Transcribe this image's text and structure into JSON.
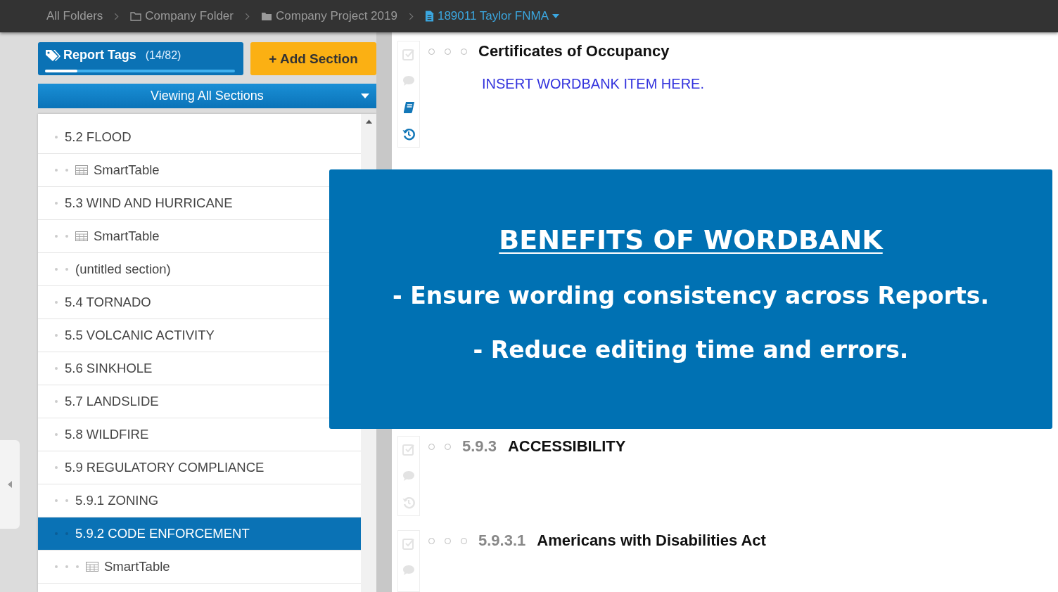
{
  "breadcrumb": [
    {
      "label": "All Folders",
      "kind": "plain",
      "selected": false
    },
    {
      "label": "Company Folder",
      "kind": "folder-outline",
      "selected": false
    },
    {
      "label": "Company Project 2019",
      "kind": "folder",
      "selected": false
    },
    {
      "label": "189011 Taylor FNMA",
      "kind": "document",
      "selected": true
    }
  ],
  "sidebar": {
    "report_tags": {
      "label": "Report Tags",
      "count": "(14/82)",
      "level": 0.17
    },
    "add_button": "+ Add Section",
    "view_dropdown": "Viewing All Sections",
    "outline": [
      {
        "label": "5.2 FLOOD",
        "kind": "section",
        "selected": false,
        "children": [
          {
            "label": "SmartTable",
            "kind": "table",
            "selected": false
          }
        ]
      },
      {
        "label": "5.3 WIND AND HURRICANE",
        "kind": "section",
        "selected": false,
        "children": [
          {
            "label": "SmartTable",
            "kind": "table",
            "selected": false
          },
          {
            "label": "(untitled section)",
            "kind": "section",
            "selected": false
          }
        ]
      },
      {
        "label": "5.4 TORNADO",
        "kind": "section",
        "selected": false
      },
      {
        "label": "5.5 VOLCANIC ACTIVITY",
        "kind": "section",
        "selected": false
      },
      {
        "label": "5.6 SINKHOLE",
        "kind": "section",
        "selected": false
      },
      {
        "label": "5.7 LANDSLIDE",
        "kind": "section",
        "selected": false
      },
      {
        "label": "5.8 WILDFIRE",
        "kind": "section",
        "selected": false
      },
      {
        "label": "5.9 REGULATORY COMPLIANCE",
        "kind": "section",
        "selected": false,
        "children": [
          {
            "label": "5.9.1 ZONING",
            "kind": "section",
            "selected": false
          },
          {
            "label": "5.9.2 CODE ENFORCEMENT",
            "kind": "section",
            "selected": true,
            "children": [
              {
                "label": "SmartTable",
                "kind": "table",
                "selected": false
              }
            ]
          }
        ]
      }
    ]
  },
  "sections": [
    {
      "title": "Certificates of Occupancy",
      "body": "INSERT WORDBANK ITEM HERE.",
      "tools": [
        {
          "kind": "check",
          "active": false
        },
        {
          "kind": "comment",
          "active": false
        },
        {
          "kind": "book",
          "active": true
        },
        {
          "kind": "history",
          "active": true
        }
      ]
    },
    {
      "number": "5.9.3",
      "title": "ACCESSIBILITY",
      "tools": [
        {
          "kind": "check",
          "active": false
        },
        {
          "kind": "comment",
          "active": false
        },
        {
          "kind": "history",
          "active": false
        }
      ]
    },
    {
      "number": "5.9.3.1",
      "title": "Americans with Disabilities Act",
      "tools": [
        {
          "kind": "check",
          "active": false
        },
        {
          "kind": "comment",
          "active": false
        }
      ]
    }
  ],
  "overlay": {
    "title": "BENEFITS OF WORDBANK",
    "points": [
      "- Ensure wording consistency across Reports.",
      "- Reduce editing time and errors."
    ]
  }
}
